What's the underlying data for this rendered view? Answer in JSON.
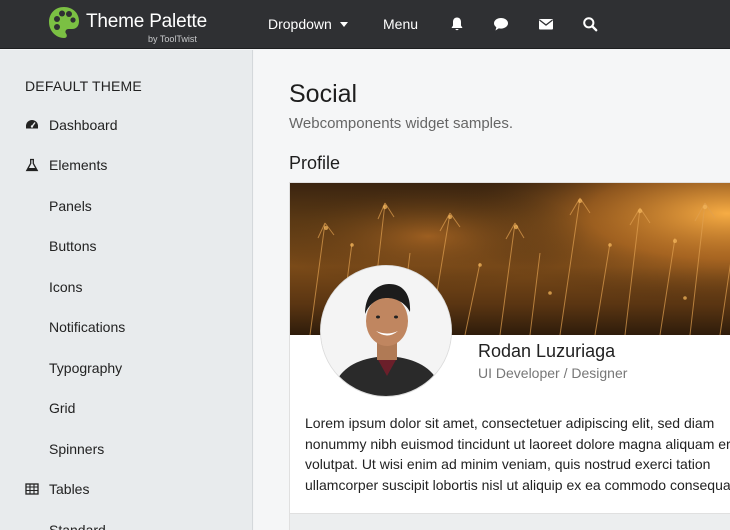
{
  "brand": {
    "name": "Theme Palette",
    "sub": "by ToolTwist"
  },
  "topnav": {
    "dropdown_label": "Dropdown",
    "menu_label": "Menu",
    "icons": [
      "bell-icon",
      "comment-icon",
      "envelope-icon",
      "search-icon"
    ]
  },
  "sidebar": {
    "header": "DEFAULT THEME",
    "items": [
      {
        "label": "Dashboard",
        "icon": "dashboard-icon"
      },
      {
        "label": "Elements",
        "icon": "flask-icon"
      },
      {
        "label": "Panels"
      },
      {
        "label": "Buttons"
      },
      {
        "label": "Icons"
      },
      {
        "label": "Notifications"
      },
      {
        "label": "Typography"
      },
      {
        "label": "Grid"
      },
      {
        "label": "Spinners"
      },
      {
        "label": "Tables",
        "icon": "table-icon"
      },
      {
        "label": "Standard"
      }
    ]
  },
  "main": {
    "title": "Social",
    "subtitle": "Webcomponents widget samples.",
    "section": "Profile",
    "profile": {
      "name": "Rodan Luzuriaga",
      "role": "UI Developer / Designer",
      "bio": "Lorem ipsum dolor sit amet, consectetuer adipiscing elit, sed diam nonummy nibh euismod tincidunt ut laoreet dolore magna aliquam erat volutpat. Ut wisi enim ad minim veniam, quis nostrud exerci tation ullamcorper suscipit lobortis nisl ut aliquip ex ea commodo consequat."
    }
  },
  "colors": {
    "topbar": "#2f3033",
    "sidebar": "#e8ebed",
    "logo": "#7bc043"
  }
}
